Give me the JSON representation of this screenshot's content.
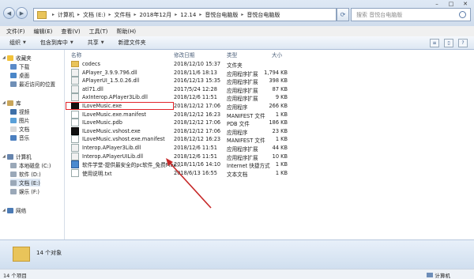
{
  "address": {
    "crumbs": [
      "计算机",
      "文档 (E:)",
      "文件档",
      "2018年12月",
      "12.14",
      "音悦台电脑版",
      "音悦台电脑版"
    ],
    "search_placeholder": "搜索 音悦台电脑版"
  },
  "menu": [
    "文件(F)",
    "编辑(E)",
    "查看(V)",
    "工具(T)",
    "帮助(H)"
  ],
  "toolbar": {
    "organize": "组织",
    "include": "包含到库中",
    "share": "共享",
    "new_folder": "新建文件夹"
  },
  "nav": {
    "favorites": "收藏夹",
    "downloads": "下载",
    "desktop": "桌面",
    "recent": "最近访问的位置",
    "libraries": "库",
    "videos": "视频",
    "pictures": "图片",
    "documents": "文档",
    "music": "音乐",
    "computer": "计算机",
    "local_c": "本地磁盘 (C:)",
    "soft_d": "软件 (D:)",
    "docs_e": "文档 (E:)",
    "ent_f": "娱乐 (F:)",
    "network": "网络"
  },
  "columns": {
    "name": "名称",
    "date": "修改日期",
    "type": "类型",
    "size": "大小"
  },
  "files": [
    {
      "name": "codecs",
      "date": "2018/12/10 15:37",
      "type": "文件夹",
      "size": "",
      "icon": "folder-icon"
    },
    {
      "name": "APlayer_3.9.9.796.dll",
      "date": "2018/11/6 18:13",
      "type": "应用程序扩展",
      "size": "1,794 KB",
      "icon": "dll-icon"
    },
    {
      "name": "APlayerUI_1.5.0.26.dll",
      "date": "2016/12/13 15:35",
      "type": "应用程序扩展",
      "size": "398 KB",
      "icon": "dll-icon"
    },
    {
      "name": "atl71.dll",
      "date": "2017/5/24 12:28",
      "type": "应用程序扩展",
      "size": "87 KB",
      "icon": "dll-icon"
    },
    {
      "name": "AxInterop.APlayer3Lib.dll",
      "date": "2018/12/6 11:51",
      "type": "应用程序扩展",
      "size": "9 KB",
      "icon": "dll-icon"
    },
    {
      "name": "ILoveMusic.exe",
      "date": "2018/12/12 17:06",
      "type": "应用程序",
      "size": "266 KB",
      "icon": "exe-icon"
    },
    {
      "name": "ILoveMusic.exe.manifest",
      "date": "2018/12/12 16:23",
      "type": "MANIFEST 文件",
      "size": "1 KB",
      "icon": "file-icon"
    },
    {
      "name": "ILoveMusic.pdb",
      "date": "2018/12/12 17:06",
      "type": "PDB 文件",
      "size": "186 KB",
      "icon": "file-icon"
    },
    {
      "name": "ILoveMusic.vshost.exe",
      "date": "2018/12/12 17:06",
      "type": "应用程序",
      "size": "23 KB",
      "icon": "exe-icon"
    },
    {
      "name": "ILoveMusic.vshost.exe.manifest",
      "date": "2018/12/12 16:23",
      "type": "MANIFEST 文件",
      "size": "1 KB",
      "icon": "file-icon"
    },
    {
      "name": "Interop.APlayer3Lib.dll",
      "date": "2018/12/6 11:51",
      "type": "应用程序扩展",
      "size": "44 KB",
      "icon": "dll-icon"
    },
    {
      "name": "Interop.APlayerUILib.dll",
      "date": "2018/12/6 11:51",
      "type": "应用程序扩展",
      "size": "10 KB",
      "icon": "dll-icon"
    },
    {
      "name": "软件学堂-提供最安全的pc软件_免费Mac...",
      "date": "2018/11/16 14:10",
      "type": "Internet 快捷方式",
      "size": "1 KB",
      "icon": "url-icon"
    },
    {
      "name": "使用说明.txt",
      "date": "2018/6/13 16:55",
      "type": "文本文档",
      "size": "1 KB",
      "icon": "txt-icon"
    }
  ],
  "details": {
    "count": "14 个对象"
  },
  "status": {
    "left": "14 个项目",
    "right": "计算机"
  }
}
